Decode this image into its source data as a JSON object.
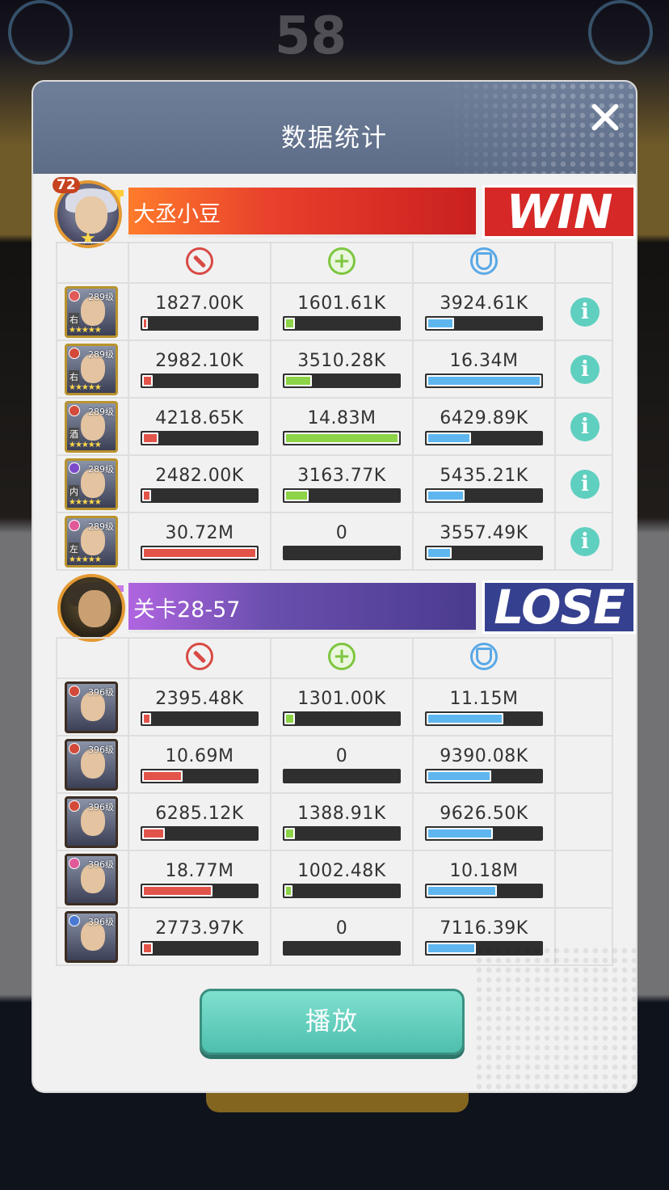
{
  "background": {
    "scoreboard_text": "58"
  },
  "modal": {
    "title": "数据统计",
    "play_label": "播放"
  },
  "teams": [
    {
      "name": "大丞小豆",
      "result": "WIN",
      "level": "72",
      "banner_color": "red",
      "heroes": [
        {
          "level": "289级",
          "position": "右",
          "damage": "1827.00K",
          "heal": "1601.61K",
          "shield": "3924.61K",
          "damage_pct": 0.05,
          "heal_pct": 0.09,
          "shield_pct": 0.24,
          "tag_color": "#e05a5a"
        },
        {
          "level": "289级",
          "position": "右",
          "damage": "2982.10K",
          "heal": "3510.28K",
          "shield": "16.34M",
          "damage_pct": 0.09,
          "heal_pct": 0.24,
          "shield_pct": 1.0,
          "tag_color": "#d44a3a"
        },
        {
          "level": "289级",
          "position": "酒",
          "damage": "4218.65K",
          "heal": "14.83M",
          "shield": "6429.89K",
          "damage_pct": 0.14,
          "heal_pct": 1.0,
          "shield_pct": 0.39,
          "tag_color": "#d44a3a"
        },
        {
          "level": "289级",
          "position": "内",
          "damage": "2482.00K",
          "heal": "3163.77K",
          "shield": "5435.21K",
          "damage_pct": 0.08,
          "heal_pct": 0.21,
          "shield_pct": 0.33,
          "tag_color": "#7b4bc9"
        },
        {
          "level": "289级",
          "position": "左",
          "damage": "30.72M",
          "heal": "0",
          "shield": "3557.49K",
          "damage_pct": 1.0,
          "heal_pct": 0.0,
          "shield_pct": 0.22,
          "tag_color": "#e05a9a"
        }
      ]
    },
    {
      "name": "关卡28-57",
      "result": "LOSE",
      "banner_color": "purple",
      "heroes": [
        {
          "level": "396级",
          "damage": "2395.48K",
          "heal": "1301.00K",
          "shield": "11.15M",
          "damage_pct": 0.08,
          "heal_pct": 0.09,
          "shield_pct": 0.67,
          "tag_color": "#d44a3a"
        },
        {
          "level": "396级",
          "damage": "10.69M",
          "heal": "0",
          "shield": "9390.08K",
          "damage_pct": 0.35,
          "heal_pct": 0.0,
          "shield_pct": 0.56,
          "tag_color": "#d44a3a"
        },
        {
          "level": "396级",
          "damage": "6285.12K",
          "heal": "1388.91K",
          "shield": "9626.50K",
          "damage_pct": 0.2,
          "heal_pct": 0.09,
          "shield_pct": 0.58,
          "tag_color": "#d44a3a"
        },
        {
          "level": "396级",
          "damage": "18.77M",
          "heal": "1002.48K",
          "shield": "10.18M",
          "damage_pct": 0.61,
          "heal_pct": 0.07,
          "shield_pct": 0.61,
          "tag_color": "#e05a9a"
        },
        {
          "level": "396级",
          "damage": "2773.97K",
          "heal": "0",
          "shield": "7116.39K",
          "damage_pct": 0.09,
          "heal_pct": 0.0,
          "shield_pct": 0.43,
          "tag_color": "#4a7ad4"
        }
      ]
    }
  ],
  "icons": {
    "damage": "sword-icon",
    "heal": "plus-icon",
    "shield": "shield-icon",
    "info": "info-icon",
    "close": "close-icon"
  },
  "colors": {
    "damage": "#e2544a",
    "heal": "#8cd347",
    "shield": "#5fb6ef",
    "info": "#5fcfc0",
    "win": "#d62826",
    "lose": "#35408f"
  }
}
